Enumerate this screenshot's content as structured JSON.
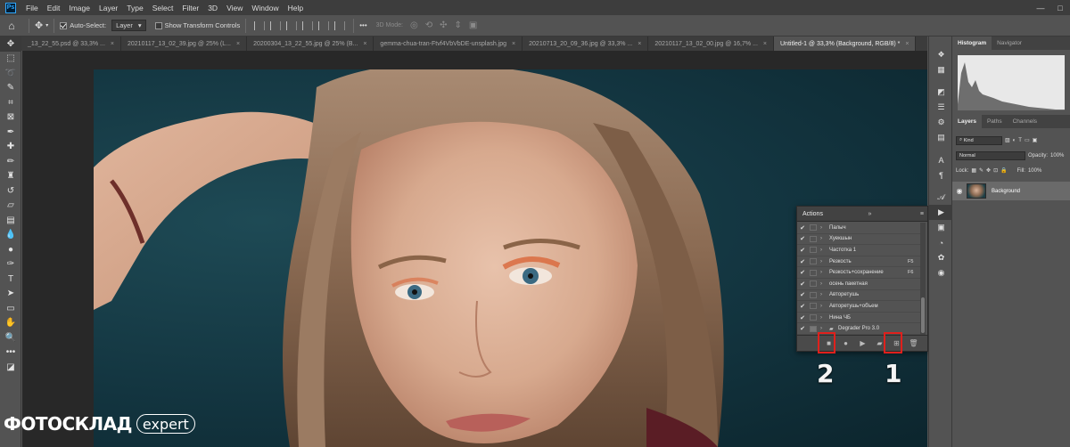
{
  "menubar": {
    "logo": "Ps",
    "items": [
      "File",
      "Edit",
      "Image",
      "Layer",
      "Type",
      "Select",
      "Filter",
      "3D",
      "View",
      "Window",
      "Help"
    ],
    "minimize": "—",
    "maximize": "□"
  },
  "options": {
    "auto_select_label": "Auto-Select:",
    "auto_select_value": "Layer",
    "show_transform_label": "Show Transform Controls",
    "more": "•••",
    "mode_3d": "3D Mode:"
  },
  "tabs": [
    {
      "label": "_13_22_55.psd @ 33,3% ..."
    },
    {
      "label": "20210117_13_02_39.jpg @ 25% (L..."
    },
    {
      "label": "20200304_13_22_55.jpg @ 25% (B..."
    },
    {
      "label": "gemma-chua-tran-Ftvf4VbVbDE-unsplash.jpg"
    },
    {
      "label": "20210713_20_09_36.jpg @ 33,3% ..."
    },
    {
      "label": "20210117_13_02_00.jpg @ 16,7% ..."
    },
    {
      "label": "Untitled-1 @ 33,3% (Background, RGB/8) *",
      "active": true
    }
  ],
  "actions_panel": {
    "title": "Actions",
    "items": [
      {
        "name": "Палыч",
        "key": ""
      },
      {
        "name": "Хуекшын",
        "key": ""
      },
      {
        "name": "Частотка 1",
        "key": ""
      },
      {
        "name": "Резкость",
        "key": "F5"
      },
      {
        "name": "Резкость+сохранение",
        "key": "F6"
      },
      {
        "name": "осень пакетная",
        "key": ""
      },
      {
        "name": "Авторетушь",
        "key": ""
      },
      {
        "name": "Авторетушь+объем",
        "key": ""
      },
      {
        "name": "Нина ЧБ",
        "key": ""
      },
      {
        "name": "Degrader Pro 3.0",
        "key": ""
      }
    ]
  },
  "annotations": {
    "label_1": "1",
    "label_2": "2"
  },
  "right_panels": {
    "top_tabs": [
      "Histogram",
      "Navigator"
    ],
    "layer_tabs": [
      "Layers",
      "Paths",
      "Channels"
    ],
    "kind_label": "Kind",
    "blend_mode": "Normal",
    "opacity_label": "Opacity:",
    "opacity_value": "100%",
    "lock_label": "Lock:",
    "fill_label": "Fill:",
    "fill_value": "100%",
    "layer_name": "Background"
  },
  "brand": {
    "name": "ФОТОСКЛАД",
    "suffix": "expert"
  },
  "colors": {
    "highlight": "#e0201c",
    "active_tab": "#535353",
    "app_bg": "#535353"
  }
}
